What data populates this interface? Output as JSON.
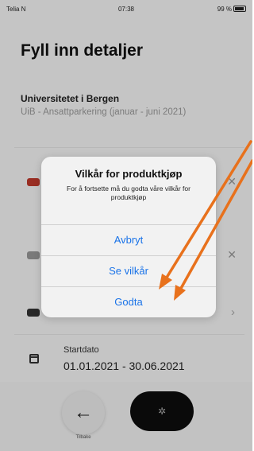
{
  "status_bar": {
    "carrier": "Telia N",
    "time": "07:38",
    "battery": "99 %"
  },
  "page": {
    "title": "Fyll inn detaljer"
  },
  "organization": {
    "name": "Universitetet i Bergen",
    "subtitle": "UiB - Ansattparkering (januar - juni 2021)"
  },
  "vehicle_rows": [
    {
      "icon": "car-icon",
      "action_icon": "close-icon"
    },
    {
      "icon": "car-icon",
      "action_icon": "close-icon"
    },
    {
      "icon": "car-icon",
      "action_icon": "chevron-right-icon"
    }
  ],
  "start_date": {
    "label": "Startdato",
    "value": "01.01.2021 - 30.06.2021"
  },
  "bottom_nav": {
    "back_label": "Tilbake"
  },
  "dialog": {
    "title": "Vilkår for produktkjøp",
    "message": "For å fortsette må du godta våre vilkår for produktkjøp",
    "buttons": {
      "cancel": "Avbryt",
      "view_terms": "Se vilkår",
      "accept": "Godta"
    }
  },
  "annotation": {
    "arrow_color": "#e8711c"
  },
  "colors": {
    "accent": "#1a73e8",
    "background": "#f7f7f7"
  }
}
